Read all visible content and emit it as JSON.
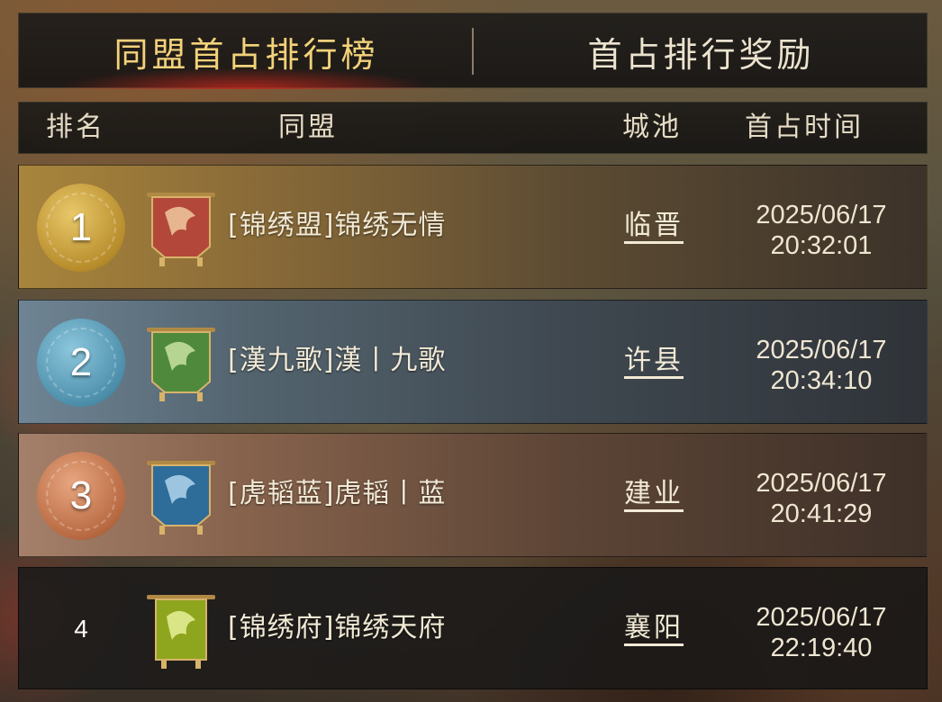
{
  "tabs": {
    "active": "同盟首占排行榜",
    "reward": "首占排行奖励"
  },
  "header": {
    "rank": "排名",
    "alliance": "同盟",
    "city": "城池",
    "time": "首占时间"
  },
  "rows": [
    {
      "rank": "1",
      "medal": "gold",
      "banner_color": "#b3483a",
      "alliance": "[锦绣盟]锦绣无情",
      "city": "临晋",
      "date": "2025/06/17",
      "time": "20:32:01"
    },
    {
      "rank": "2",
      "medal": "silver",
      "banner_color": "#4f8a3c",
      "alliance": "[漢九歌]漢丨九歌",
      "city": "许县",
      "date": "2025/06/17",
      "time": "20:34:10"
    },
    {
      "rank": "3",
      "medal": "bronze",
      "banner_color": "#2e6c9a",
      "alliance": "[虎韬蓝]虎韬丨蓝",
      "city": "建业",
      "date": "2025/06/17",
      "time": "20:41:29"
    },
    {
      "rank": "4",
      "medal": "none",
      "banner_color": "#8ea51e",
      "alliance": "[锦绣府]锦绣天府",
      "city": "襄阳",
      "date": "2025/06/17",
      "time": "22:19:40"
    }
  ],
  "icons": {
    "medal": "rank-medal-icon",
    "banner": "alliance-banner-icon"
  }
}
